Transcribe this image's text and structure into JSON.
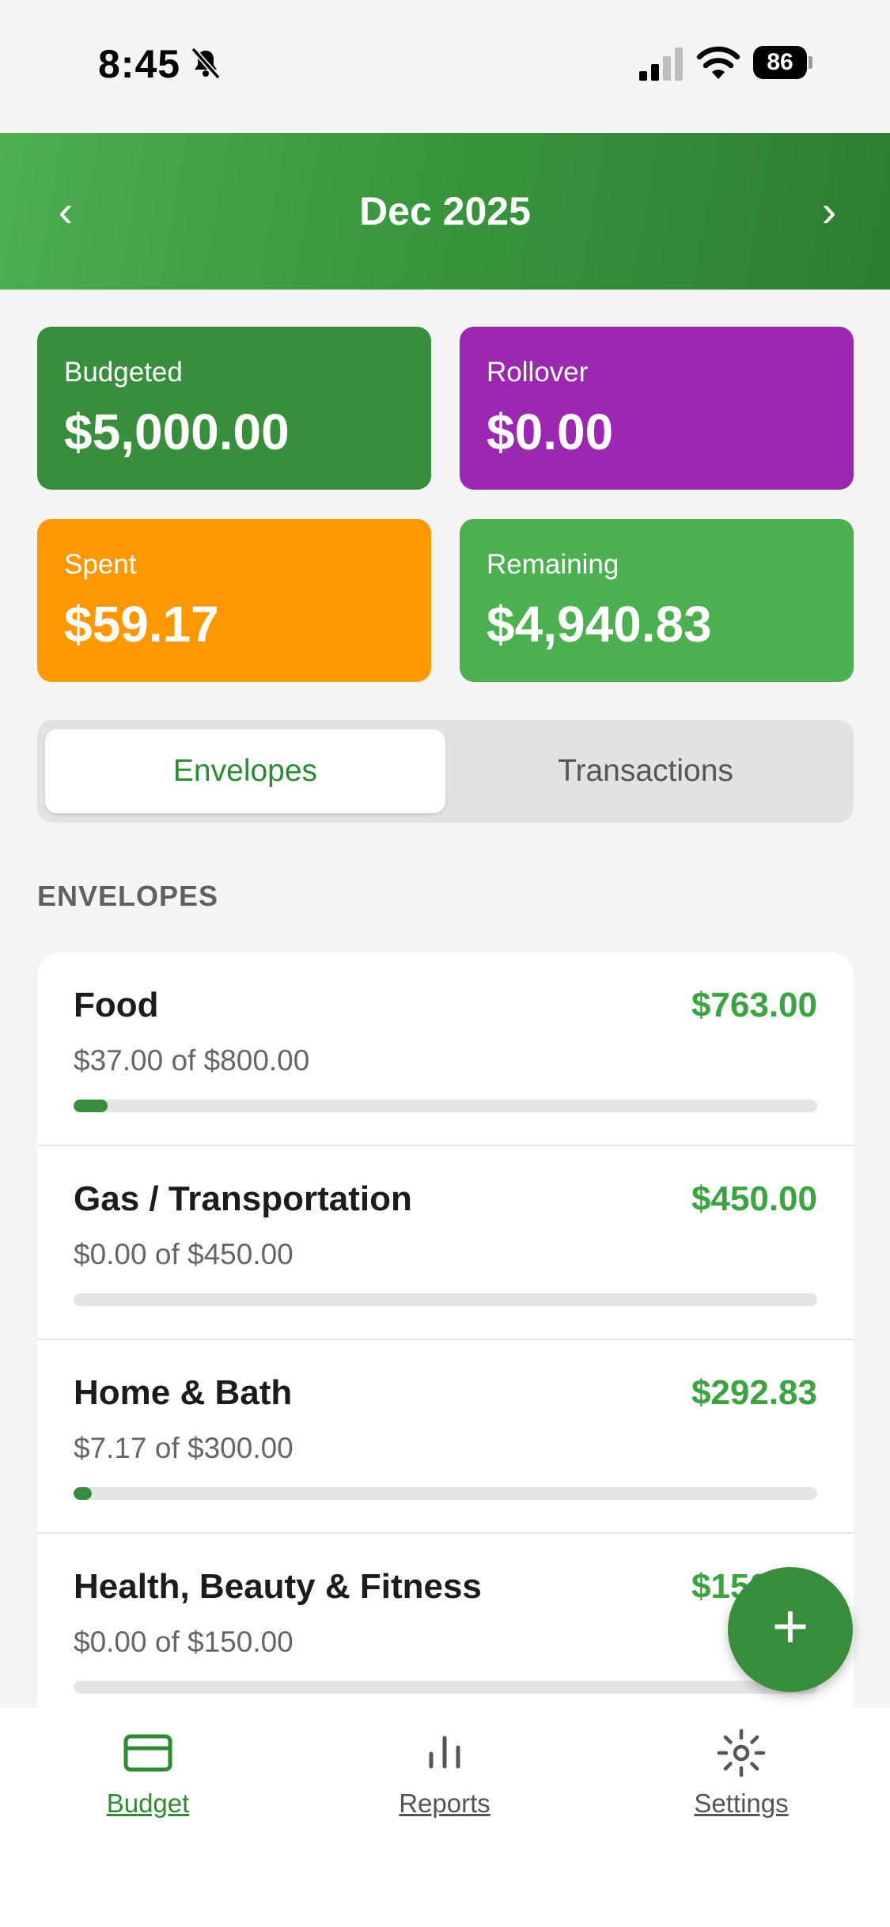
{
  "status_bar": {
    "time": "8:45",
    "battery": "86"
  },
  "header": {
    "title": "Dec 2025",
    "prev": "‹",
    "next": "›"
  },
  "summary": {
    "budgeted": {
      "label": "Budgeted",
      "value": "$5,000.00",
      "color": "#388e3c"
    },
    "rollover": {
      "label": "Rollover",
      "value": "$0.00",
      "color": "#9c27b0"
    },
    "spent": {
      "label": "Spent",
      "value": "$59.17",
      "color": "#ff9800"
    },
    "remaining": {
      "label": "Remaining",
      "value": "$4,940.83",
      "color": "#4caf50"
    }
  },
  "segment": {
    "envelopes": "Envelopes",
    "transactions": "Transactions",
    "selected": "Envelopes"
  },
  "section_title": "ENVELOPES",
  "envelopes": [
    {
      "name": "Food",
      "remaining": "$763.00",
      "usage": "$37.00 of $800.00",
      "progress": 0.046
    },
    {
      "name": "Gas / Transportation",
      "remaining": "$450.00",
      "usage": "$0.00 of $450.00",
      "progress": 0
    },
    {
      "name": "Home & Bath",
      "remaining": "$292.83",
      "usage": "$7.17 of $300.00",
      "progress": 0.024
    },
    {
      "name": "Health, Beauty & Fitness",
      "remaining": "$150.00",
      "usage": "$0.00 of $150.00",
      "progress": 0
    }
  ],
  "fab": {
    "label": "+"
  },
  "tabs": {
    "budget": "Budget",
    "reports": "Reports",
    "settings": "Settings",
    "active": "Budget"
  },
  "colors": {
    "primary": "#388e3c",
    "accent_text": "#3ba33f"
  },
  "icons": {
    "status": [
      "bell-slash-icon",
      "signal-icon",
      "wifi-icon",
      "battery-icon"
    ],
    "tabs": [
      "card-icon",
      "bar-chart-icon",
      "gear-icon"
    ]
  }
}
